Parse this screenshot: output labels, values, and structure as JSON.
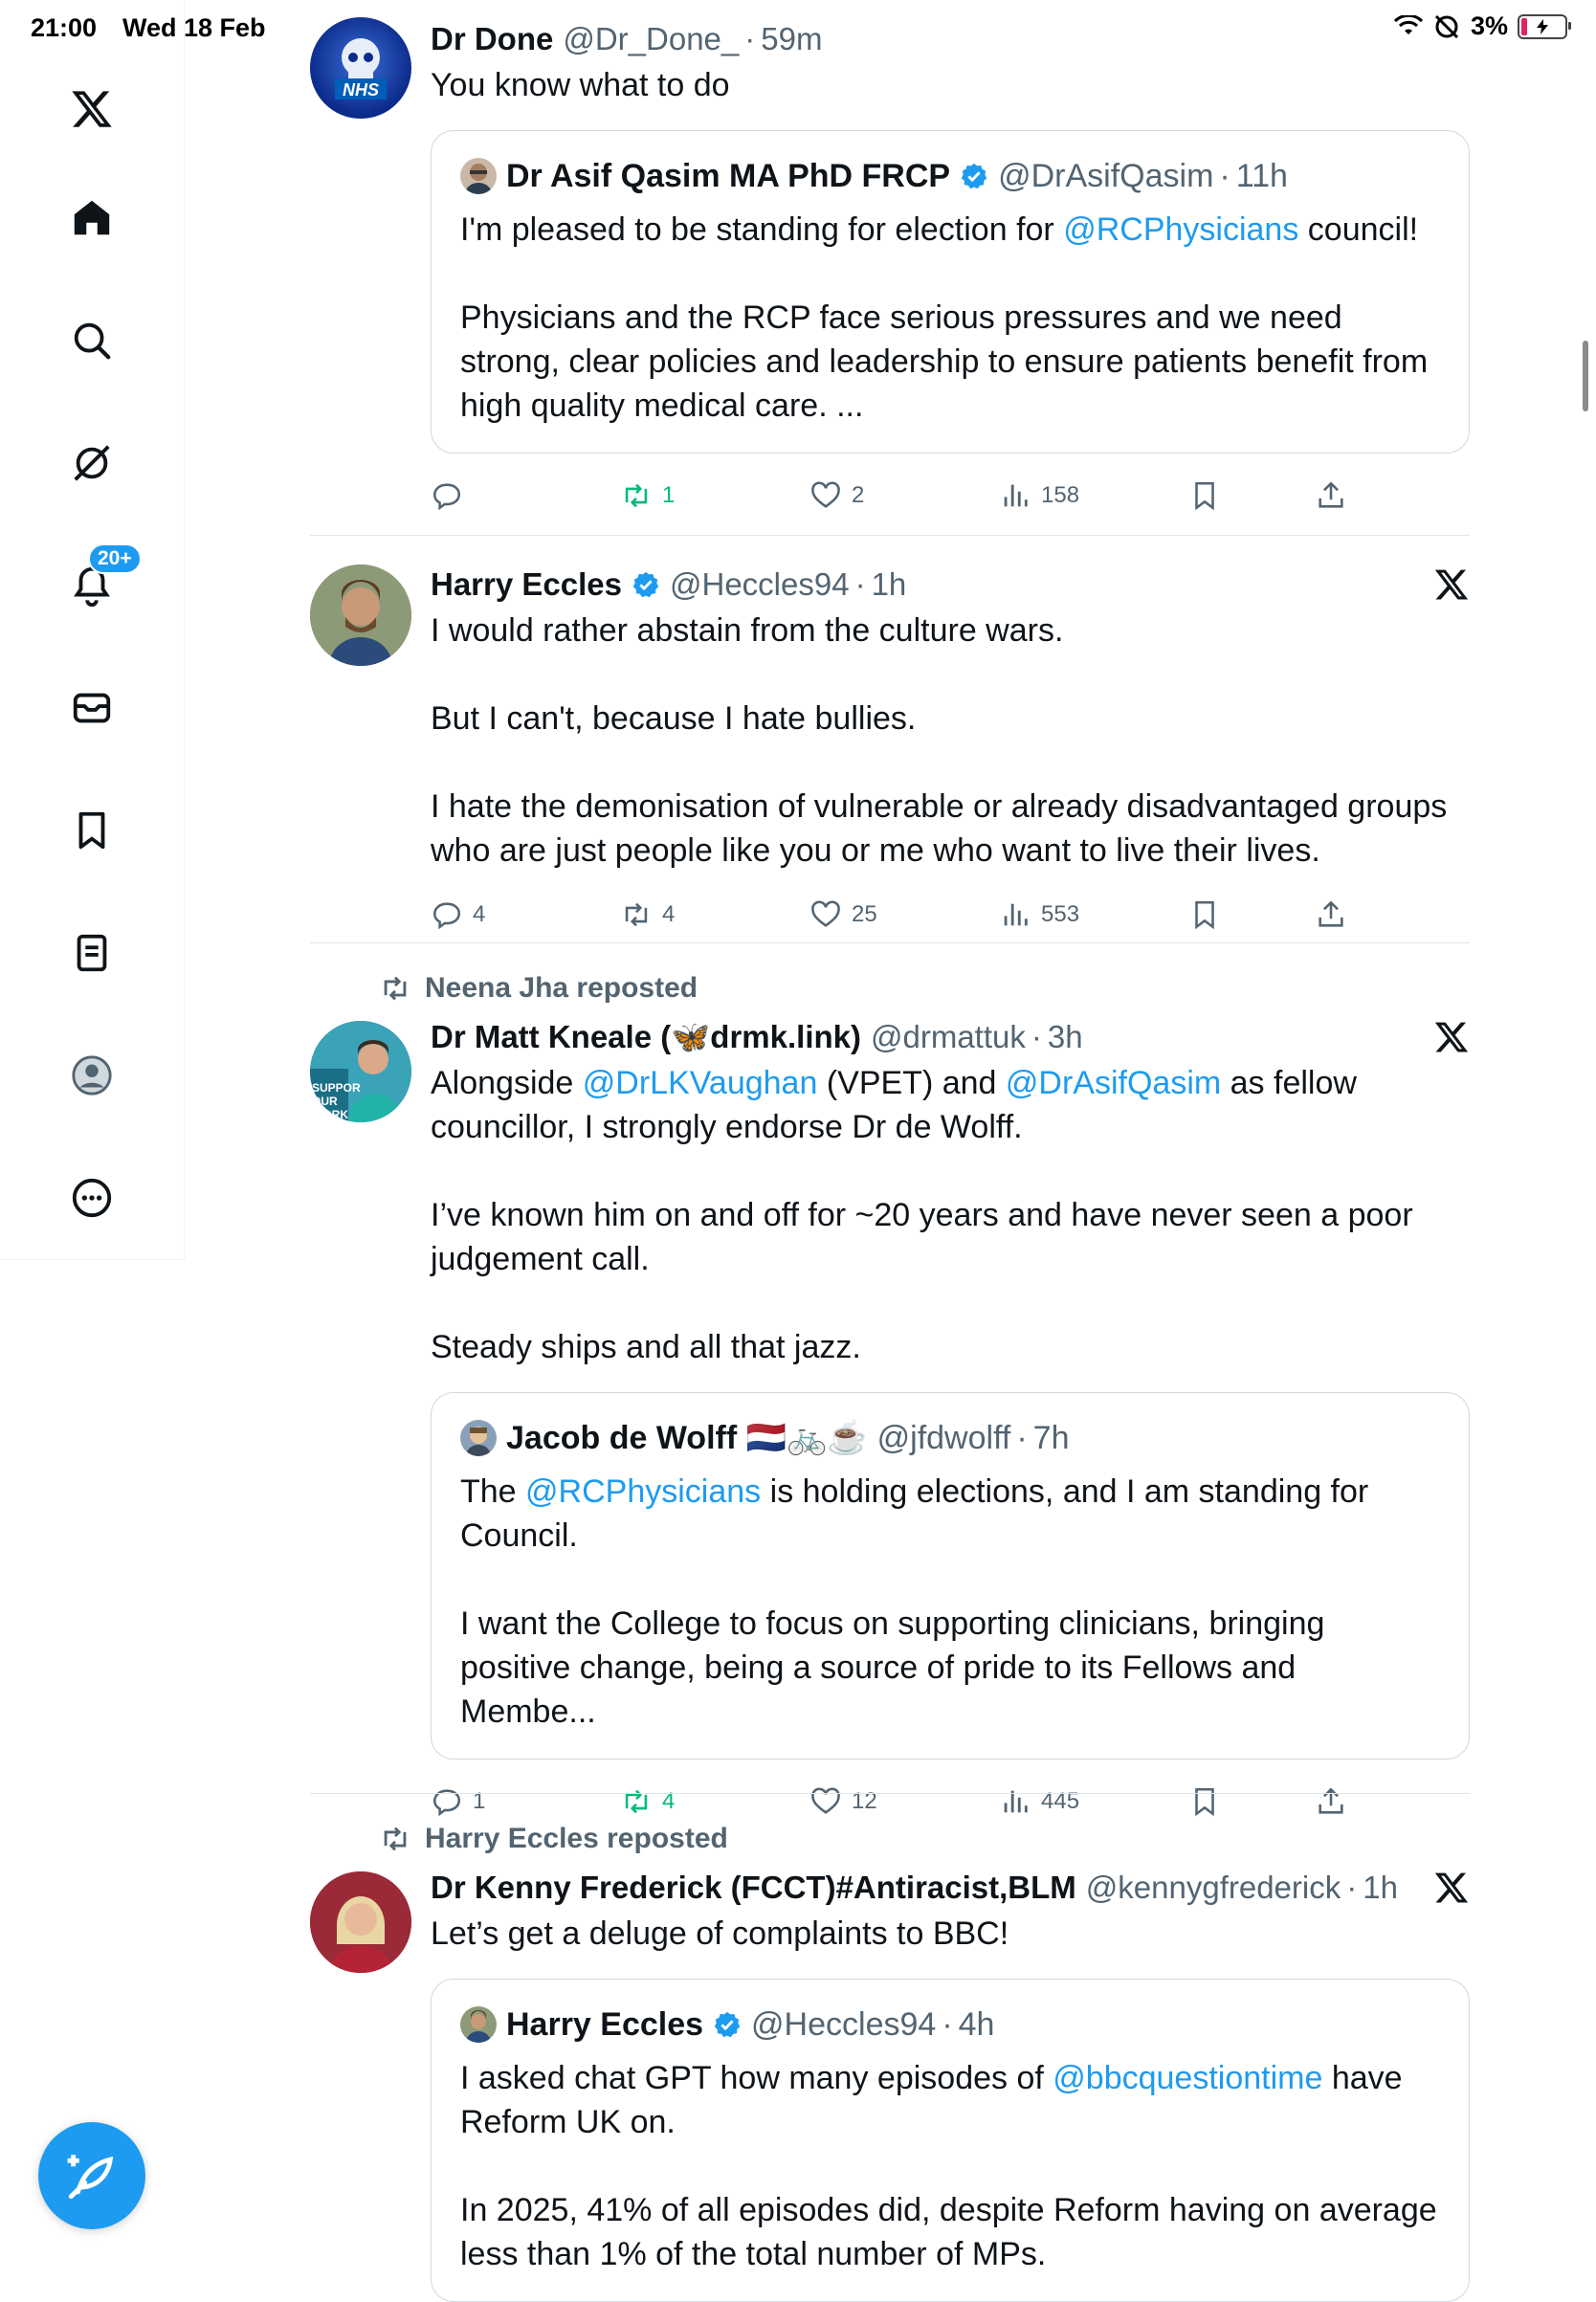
{
  "status_bar": {
    "time": "21:00",
    "date": "Wed 18 Feb",
    "battery": "3%"
  },
  "sidebar": {
    "items": [
      {
        "name": "x-logo-icon"
      },
      {
        "name": "home-icon"
      },
      {
        "name": "search-icon"
      },
      {
        "name": "grok-icon"
      },
      {
        "name": "bell-icon"
      },
      {
        "name": "mail-icon"
      },
      {
        "name": "bookmark-icon"
      },
      {
        "name": "lists-icon"
      },
      {
        "name": "profile-icon"
      },
      {
        "name": "more-icon"
      }
    ],
    "notifications_badge": "20+"
  },
  "posts": [
    {
      "name": "Dr Done",
      "handle": "@Dr_Done_",
      "time": "59m",
      "text": [
        "You know what to do"
      ],
      "quote": {
        "name": "Dr Asif Qasim MA PhD FRCP",
        "handle": "@DrAsifQasim",
        "time": "11h",
        "p1_pre": "I'm pleased to be standing for election for ",
        "p1_mention": "@RCPhysicians",
        "p1_post": " council!",
        "p2": "Physicians and the RCP face serious pressures and we need strong, clear policies and leadership to ensure patients benefit from high quality medical care. ..."
      },
      "stats": {
        "replies": "",
        "reposts": "1",
        "likes": "2",
        "views": "158"
      }
    },
    {
      "name": "Harry Eccles",
      "handle": "@Heccles94",
      "time": "1h",
      "text": [
        "I would rather abstain from the culture wars.",
        "But I can't, because I hate bullies.",
        "I hate the demonisation of vulnerable or already disadvantaged groups who are just people like you or me who want to live their lives."
      ],
      "stats": {
        "replies": "4",
        "reposts": "4",
        "likes": "25",
        "views": "553"
      }
    },
    {
      "reposted_by": "Neena Jha reposted",
      "name": "Dr Matt Kneale (🦋drmk.link)",
      "handle": "@drmattuk",
      "time": "3h",
      "t1_pre": "Alongside ",
      "t1_m1": "@DrLKVaughan",
      "t1_mid": " (VPET) and ",
      "t1_m2": "@DrAsifQasim",
      "t1_post": " as fellow councillor, I strongly endorse Dr de Wolff.",
      "text": [
        "I’ve known him on and off for ~20 years and have never seen a poor judgement call.",
        "Steady ships and all that jazz."
      ],
      "quote": {
        "name": "Jacob de Wolff 🇳🇱🚲☕",
        "handle": "@jfdwolff",
        "time": "7h",
        "p1_pre": "The ",
        "p1_mention": "@RCPhysicians",
        "p1_post": " is holding elections, and I am standing for Council.",
        "p2": "I want the College to focus on supporting clinicians, bringing positive change, being a source of pride to its Fellows and Membe..."
      },
      "stats": {
        "replies": "1",
        "reposts": "4",
        "likes": "12",
        "views": "445"
      }
    },
    {
      "reposted_by": "Harry Eccles reposted",
      "name": "Dr Kenny Frederick (FCCT)#Antiracist,BLM",
      "handle": "@kennygfrederick",
      "time": "1h",
      "text": [
        "Let’s get a deluge of complaints to BBC!"
      ],
      "quote": {
        "name": "Harry Eccles",
        "handle": "@Heccles94",
        "time": "4h",
        "p1_pre": "I asked chat GPT how many episodes of ",
        "p1_mention": "@bbcquestiontime",
        "p1_post": " have Reform UK on.",
        "p2": "In 2025, 41% of all episodes did, despite Reform having on average less than 1% of the total number of MPs."
      }
    }
  ],
  "colors": {
    "accent": "#1d9bf0",
    "repost_active": "#00ba7c",
    "muted": "#536471"
  }
}
